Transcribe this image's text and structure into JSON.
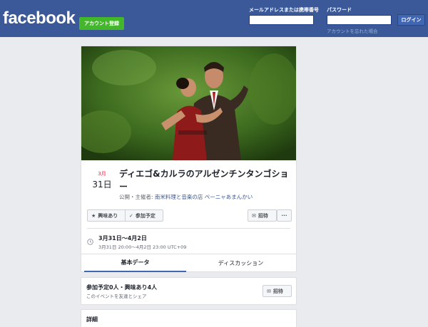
{
  "header": {
    "logo": "facebook",
    "signup_label": "アカウント登録",
    "email_label": "メールアドレスまたは携帯番号",
    "password_label": "パスワード",
    "login_label": "ログイン",
    "forgot_label": "アカウントを忘れた場合",
    "email_value": "",
    "password_value": ""
  },
  "event": {
    "month": "3月",
    "day": "31日",
    "title": "ディエゴ&カルラのアルゼンチンタンゴショー",
    "host_prefix": "公開・主催者: ",
    "host_name": "南米料理と音楽の店 ペーニャあまんかい",
    "interest_label": "興味あり",
    "going_label": "参加予定",
    "invite_label": "招待",
    "more_label": "···",
    "date_range": "3月31日～4月2日",
    "date_detail": "3月31日 20:00～4月2日 23:00 UTC+09"
  },
  "tabs": [
    {
      "label": "基本データ"
    },
    {
      "label": "ディスカッション"
    }
  ],
  "attendance": {
    "counts": "参加予定0人・興味あり4人",
    "share": "このイベントを友達とシェア",
    "invite_label": "招待"
  },
  "details": {
    "title": "詳細"
  },
  "colors": {
    "header_bg": "#3b5998",
    "signup_green": "#42b72a",
    "date_red": "#f02849",
    "link_blue": "#385898"
  }
}
